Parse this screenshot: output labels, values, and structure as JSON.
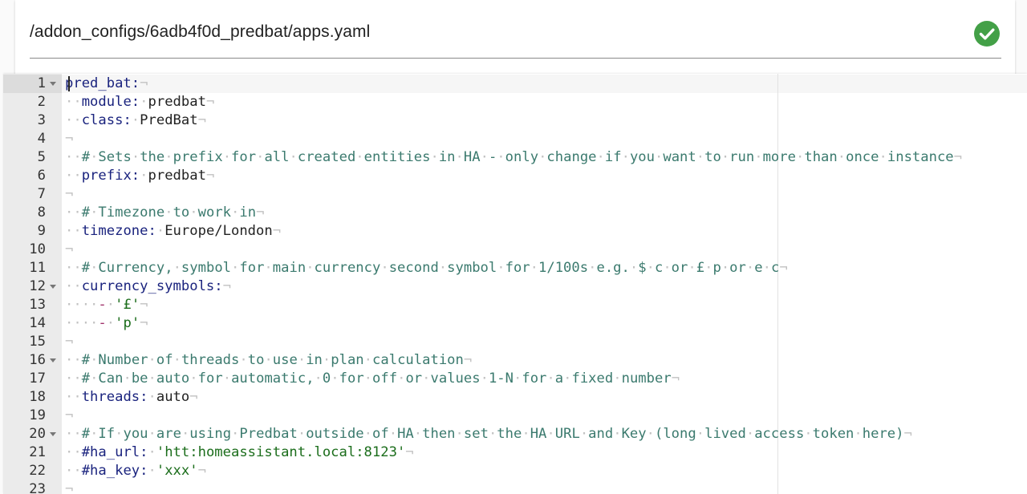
{
  "header": {
    "file_path": "/addon_configs/6adb4f0d_predbat/apps.yaml",
    "status_icon": "check-circle-icon",
    "status_color": "#43a047"
  },
  "editor": {
    "lines": [
      {
        "n": "1",
        "fold": true,
        "indent": "",
        "segments": [
          {
            "t": "key",
            "v": "pred_bat:"
          }
        ]
      },
      {
        "n": "2",
        "fold": false,
        "indent": "··",
        "segments": [
          {
            "t": "key",
            "v": "module:"
          },
          {
            "t": "sp",
            "v": " "
          },
          {
            "t": "val",
            "v": "predbat"
          }
        ]
      },
      {
        "n": "3",
        "fold": false,
        "indent": "··",
        "segments": [
          {
            "t": "key",
            "v": "class:"
          },
          {
            "t": "sp",
            "v": " "
          },
          {
            "t": "val",
            "v": "PredBat"
          }
        ]
      },
      {
        "n": "4",
        "fold": false,
        "indent": "",
        "segments": []
      },
      {
        "n": "5",
        "fold": false,
        "indent": "··",
        "segments": [
          {
            "t": "cmt",
            "v": "# Sets the prefix for all created entities in HA - only change if you want to run more than once instance"
          }
        ]
      },
      {
        "n": "6",
        "fold": false,
        "indent": "··",
        "segments": [
          {
            "t": "key",
            "v": "prefix:"
          },
          {
            "t": "sp",
            "v": " "
          },
          {
            "t": "val",
            "v": "predbat"
          }
        ]
      },
      {
        "n": "7",
        "fold": false,
        "indent": "",
        "segments": []
      },
      {
        "n": "8",
        "fold": false,
        "indent": "··",
        "segments": [
          {
            "t": "cmt",
            "v": "# Timezone to work in"
          }
        ]
      },
      {
        "n": "9",
        "fold": false,
        "indent": "··",
        "segments": [
          {
            "t": "key",
            "v": "timezone:"
          },
          {
            "t": "sp",
            "v": " "
          },
          {
            "t": "val",
            "v": "Europe/London"
          }
        ]
      },
      {
        "n": "10",
        "fold": false,
        "indent": "",
        "segments": []
      },
      {
        "n": "11",
        "fold": false,
        "indent": "··",
        "segments": [
          {
            "t": "cmt",
            "v": "# Currency, symbol for main currency second symbol for 1/100s e.g. $ c or £ p or e c"
          }
        ]
      },
      {
        "n": "12",
        "fold": true,
        "indent": "··",
        "segments": [
          {
            "t": "key",
            "v": "currency_symbols:"
          }
        ]
      },
      {
        "n": "13",
        "fold": false,
        "indent": "····",
        "segments": [
          {
            "t": "dash",
            "v": "-"
          },
          {
            "t": "sp",
            "v": " "
          },
          {
            "t": "str",
            "v": "'£'"
          }
        ]
      },
      {
        "n": "14",
        "fold": false,
        "indent": "····",
        "segments": [
          {
            "t": "dash",
            "v": "-"
          },
          {
            "t": "sp",
            "v": " "
          },
          {
            "t": "str",
            "v": "'p'"
          }
        ]
      },
      {
        "n": "15",
        "fold": false,
        "indent": "",
        "segments": []
      },
      {
        "n": "16",
        "fold": true,
        "indent": "··",
        "segments": [
          {
            "t": "cmt",
            "v": "# Number of threads to use in plan calculation"
          }
        ]
      },
      {
        "n": "17",
        "fold": false,
        "indent": "··",
        "segments": [
          {
            "t": "cmt",
            "v": "# Can be auto for automatic, 0 for off or values 1-N for a fixed number"
          }
        ]
      },
      {
        "n": "18",
        "fold": false,
        "indent": "··",
        "segments": [
          {
            "t": "key",
            "v": "threads:"
          },
          {
            "t": "sp",
            "v": " "
          },
          {
            "t": "val",
            "v": "auto"
          }
        ]
      },
      {
        "n": "19",
        "fold": false,
        "indent": "",
        "segments": []
      },
      {
        "n": "20",
        "fold": true,
        "indent": "··",
        "segments": [
          {
            "t": "cmt",
            "v": "# If you are using Predbat outside of HA then set the HA URL and Key (long lived access token here)"
          }
        ]
      },
      {
        "n": "21",
        "fold": false,
        "indent": "··",
        "segments": [
          {
            "t": "key",
            "v": "#ha_url:"
          },
          {
            "t": "sp",
            "v": " "
          },
          {
            "t": "str",
            "v": "'htt:homeassistant.local:8123'"
          }
        ]
      },
      {
        "n": "22",
        "fold": false,
        "indent": "··",
        "segments": [
          {
            "t": "key",
            "v": "#ha_key:"
          },
          {
            "t": "sp",
            "v": " "
          },
          {
            "t": "str",
            "v": "'xxx'"
          }
        ]
      },
      {
        "n": "23",
        "fold": false,
        "indent": "",
        "segments": []
      }
    ]
  }
}
